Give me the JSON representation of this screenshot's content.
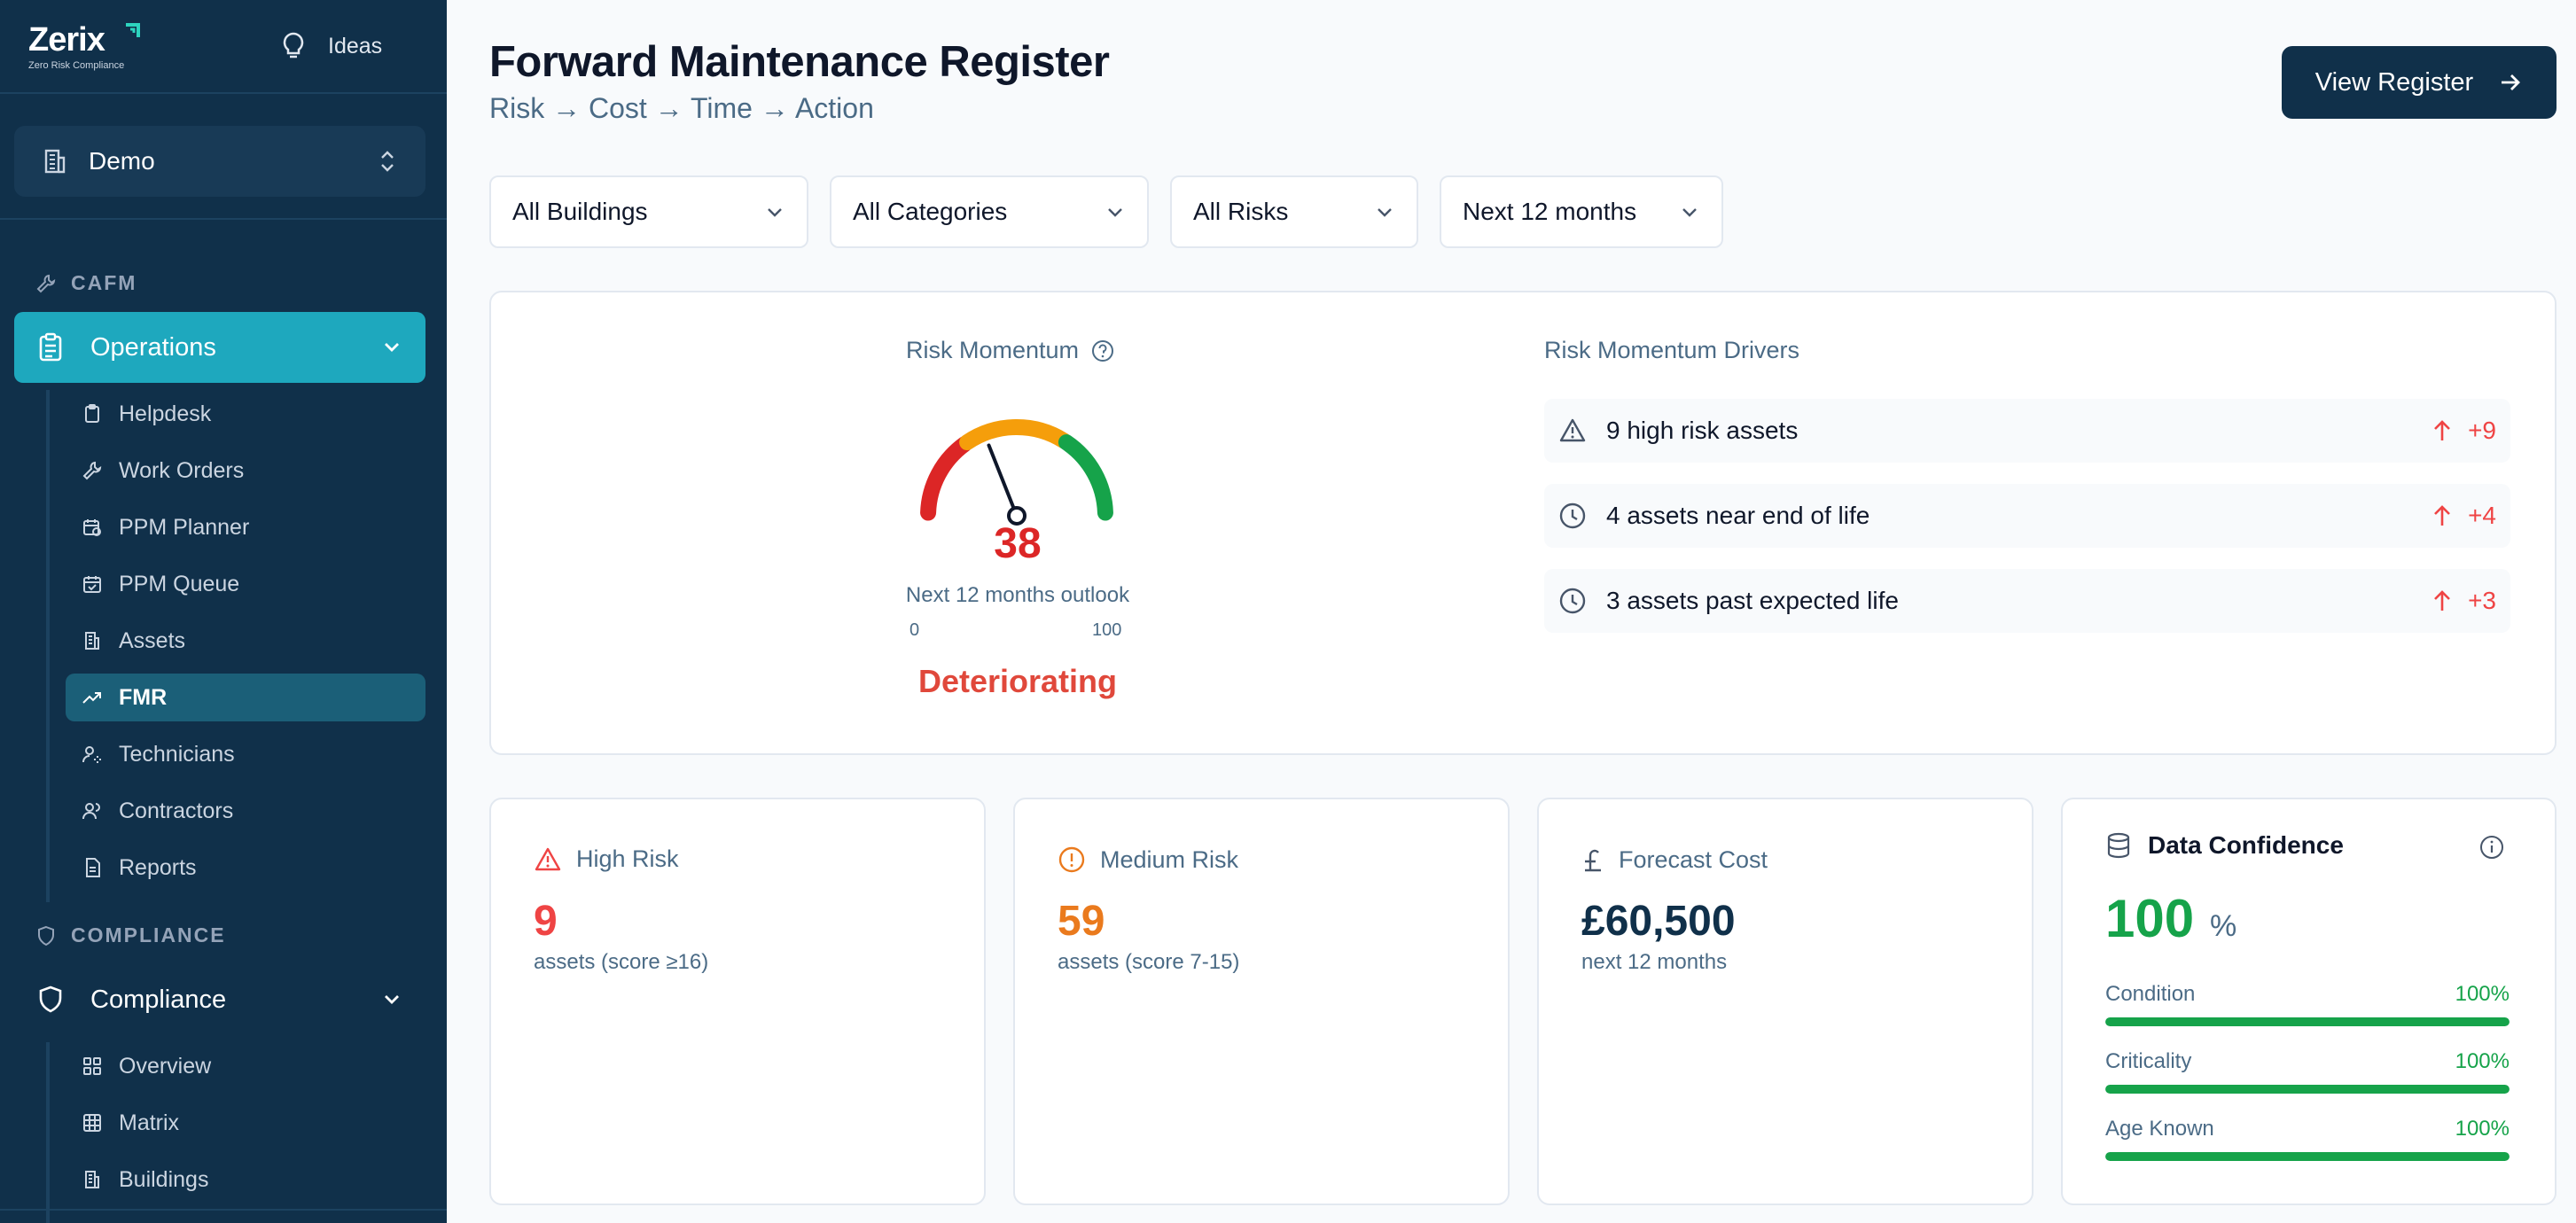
{
  "sidebar": {
    "brand": {
      "name": "Zerix",
      "tagline": "Zero Risk Compliance"
    },
    "ideas_label": "Ideas",
    "org": {
      "label": "Demo"
    },
    "sections": [
      {
        "label": "CAFM",
        "group": "Operations",
        "items": [
          {
            "label": "Helpdesk",
            "icon": "clipboard-icon"
          },
          {
            "label": "Work Orders",
            "icon": "wrench-icon"
          },
          {
            "label": "PPM Planner",
            "icon": "calendar-clock-icon"
          },
          {
            "label": "PPM Queue",
            "icon": "calendar-check-icon"
          },
          {
            "label": "Assets",
            "icon": "building-icon"
          },
          {
            "label": "FMR",
            "icon": "trending-up-icon",
            "active": true
          },
          {
            "label": "Technicians",
            "icon": "user-cog-icon"
          },
          {
            "label": "Contractors",
            "icon": "users-icon"
          },
          {
            "label": "Reports",
            "icon": "file-text-icon"
          }
        ]
      },
      {
        "label": "COMPLIANCE",
        "group": "Compliance",
        "items": [
          {
            "label": "Overview",
            "icon": "grid-icon"
          },
          {
            "label": "Matrix",
            "icon": "table-icon"
          },
          {
            "label": "Buildings",
            "icon": "building-icon"
          }
        ]
      }
    ]
  },
  "header": {
    "title": "Forward Maintenance Register",
    "subtitle": "Risk → Cost → Time → Action",
    "view_button": "View Register"
  },
  "filters": [
    {
      "value": "All Buildings"
    },
    {
      "value": "All Categories"
    },
    {
      "value": "All Risks"
    },
    {
      "value": "Next 12 months"
    }
  ],
  "momentum": {
    "title": "Risk Momentum",
    "value": "38",
    "score": 38,
    "min_label": "0",
    "max_label": "100",
    "min": 0,
    "max": 100,
    "outlook": "Next 12 months outlook",
    "status": "Deteriorating",
    "colors": {
      "low": "#dc2626",
      "mid": "#f59e0b",
      "high": "#16a34a",
      "needle": "#0f172a"
    }
  },
  "drivers": {
    "title": "Risk Momentum Drivers",
    "items": [
      {
        "text": "9 high risk assets",
        "delta": "+9",
        "icon": "alert-triangle-icon"
      },
      {
        "text": "4 assets near end of life",
        "delta": "+4",
        "icon": "clock-icon"
      },
      {
        "text": "3 assets past expected life",
        "delta": "+3",
        "icon": "clock-icon"
      }
    ]
  },
  "kpis": {
    "high": {
      "label": "High Risk",
      "value": "9",
      "note": "assets (score ≥16)",
      "color": "#ef4444"
    },
    "medium": {
      "label": "Medium Risk",
      "value": "59",
      "note": "assets (score 7-15)",
      "color": "#ea7a1d"
    },
    "cost": {
      "label": "Forecast Cost",
      "value": "£60,500",
      "note": "next 12 months",
      "color": "#10304a"
    }
  },
  "confidence": {
    "title": "Data Confidence",
    "value": "100",
    "unit": "%",
    "rows": [
      {
        "label": "Condition",
        "value": "100%",
        "fill": 1.0
      },
      {
        "label": "Criticality",
        "value": "100%",
        "fill": 1.0
      },
      {
        "label": "Age Known",
        "value": "100%",
        "fill": 1.0
      }
    ]
  }
}
